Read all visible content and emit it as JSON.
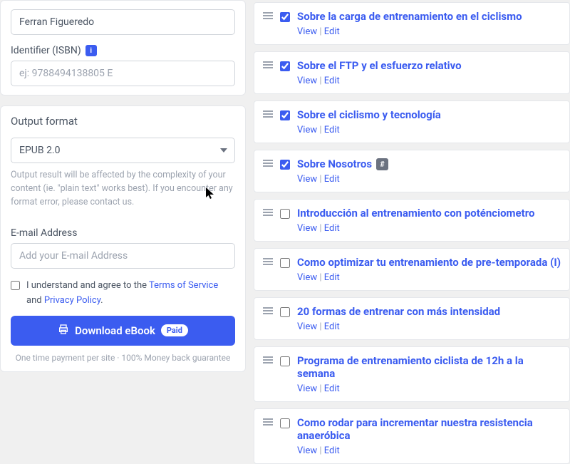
{
  "left": {
    "author_value": "Ferran Figueredo",
    "isbn_label": "Identifier (ISBN)",
    "isbn_placeholder": "ej: 9788494138805 E",
    "format_heading": "Output format",
    "format_value": "EPUB 2.0",
    "format_hint": "Output result will be affected by the complexity of your content (ie. \"plain text\" works best). If you encounter any format error, please contact us.",
    "email_label": "E-mail Address",
    "email_placeholder": "Add your E-mail Address",
    "agree_pre": "I understand and agree to the ",
    "tos": "Terms of Service",
    "agree_mid": " and ",
    "privacy": "Privacy Policy",
    "agree_post": ".",
    "download_label": "Download eBook",
    "paid": "Paid",
    "footnote": "One time payment per site · 100% Money back guarantee"
  },
  "actions": {
    "view": "View",
    "edit": "Edit"
  },
  "items": [
    {
      "title": "Sobre la carga de entrenamiento en el ciclismo",
      "checked": true
    },
    {
      "title": "Sobre el FTP y el esfuerzo relativo",
      "checked": true
    },
    {
      "title": "Sobre el ciclismo y tecnología",
      "checked": true
    },
    {
      "title": "Sobre Nosotros",
      "checked": true,
      "hash": true
    },
    {
      "title": "Introducción al entrenamiento con poténciometro",
      "checked": false
    },
    {
      "title": "Como optimizar tu entrenamiento de pre-temporada (I)",
      "checked": false
    },
    {
      "title": "20 formas de entrenar con más intensidad",
      "checked": false
    },
    {
      "title": "Programa de entrenamiento ciclista de 12h a la semana",
      "checked": false
    },
    {
      "title": "Como rodar para incrementar nuestra resistencia anaeróbica",
      "checked": false
    }
  ]
}
